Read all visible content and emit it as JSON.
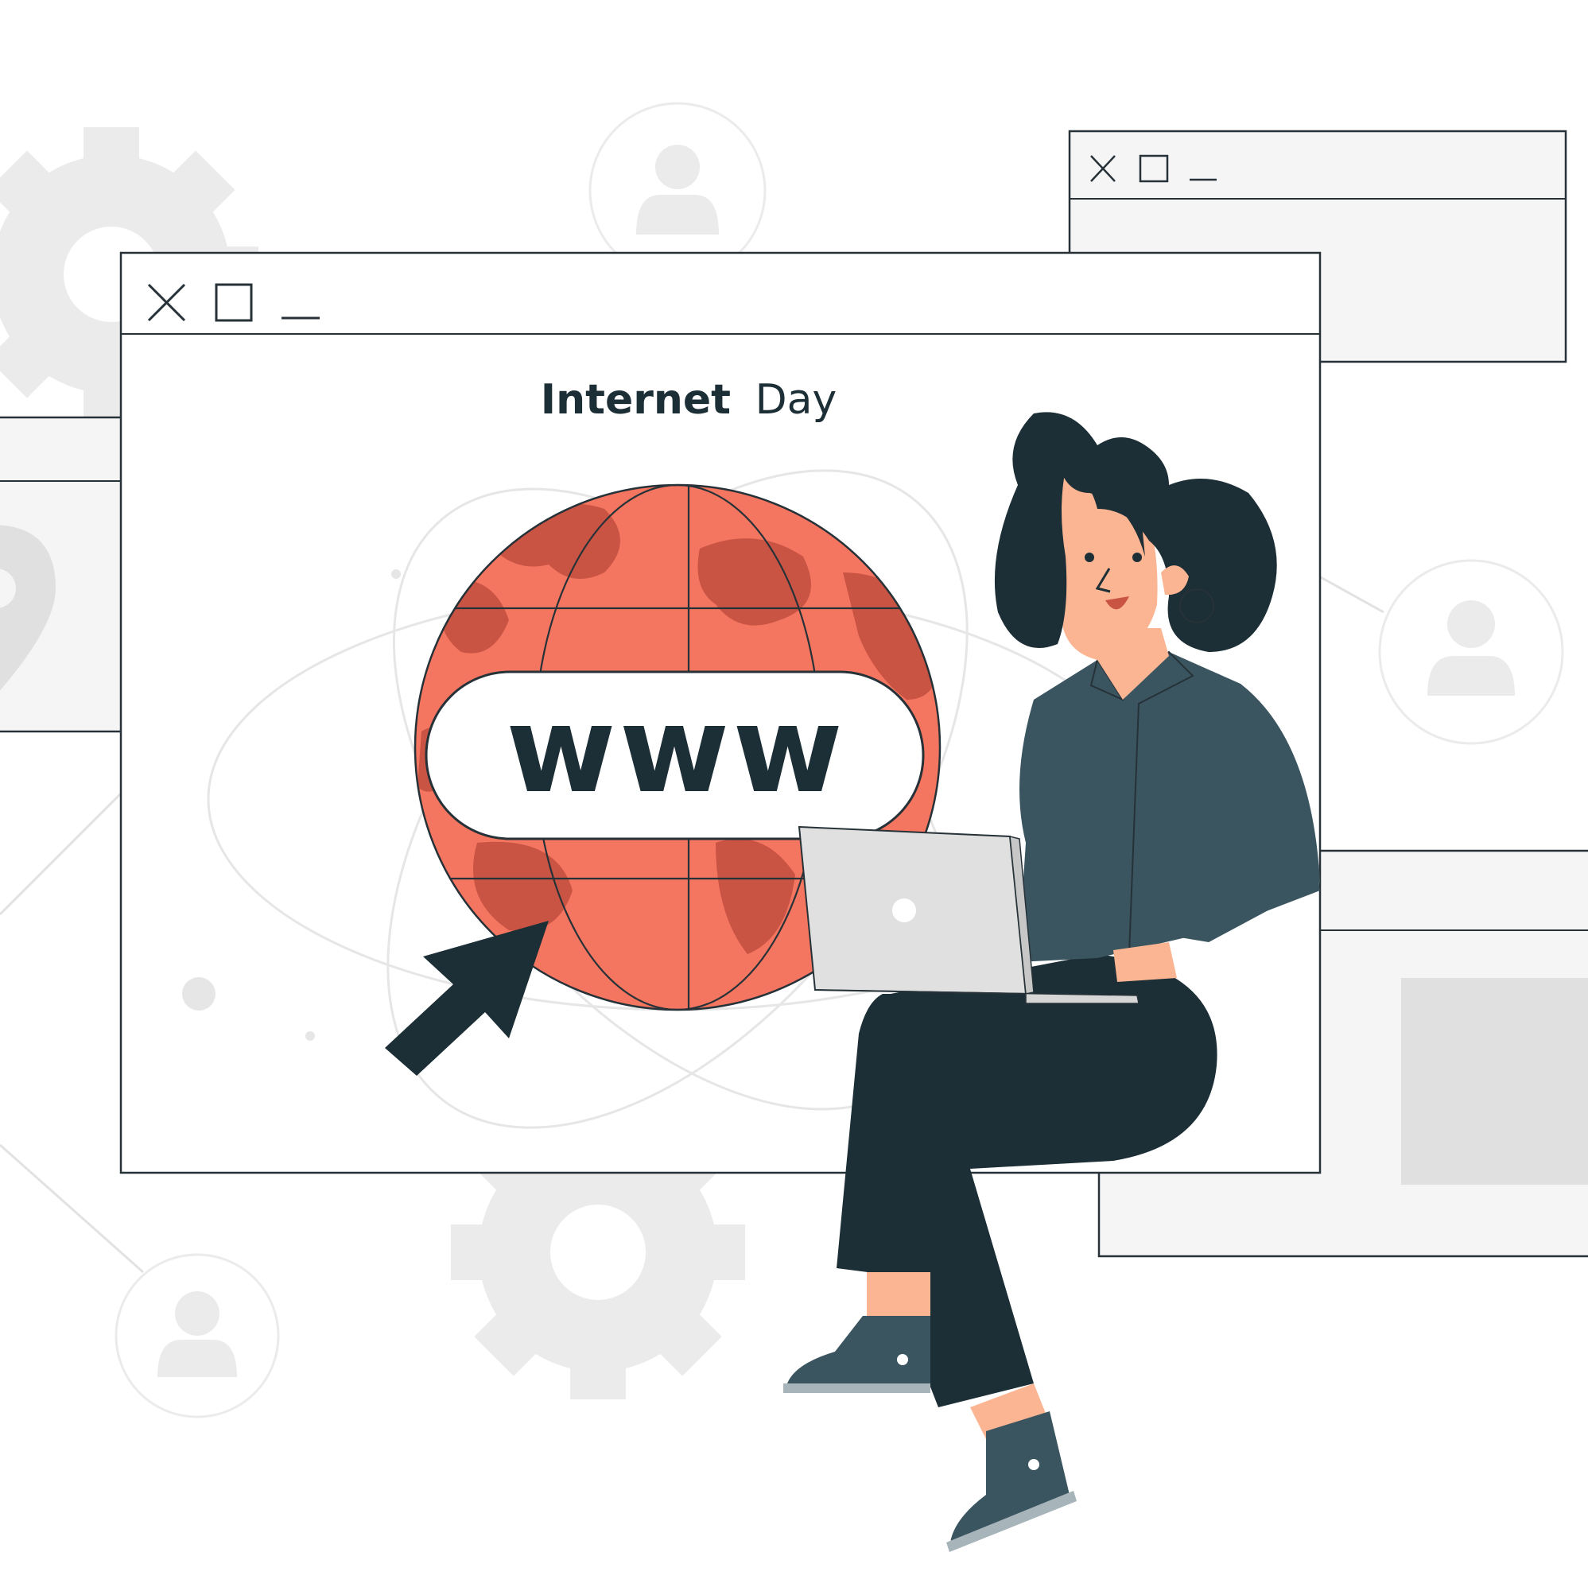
{
  "title": {
    "bold": "Internet",
    "regular": "Day"
  },
  "badge": {
    "text": "www"
  },
  "colors": {
    "globe": "#f47560",
    "globe_land": "#c95443",
    "dark": "#1c2e36",
    "shirt": "#3a5560",
    "skin": "#fcb592",
    "laptop": "#e0e0e0",
    "window_stroke": "#263238",
    "light_grey": "#ebebeb"
  },
  "icons": {
    "gears": "gear-icon",
    "profiles": "user-icon",
    "window_controls": [
      "close-icon",
      "maximize-icon",
      "minimize-icon"
    ],
    "pointer": "cursor-arrow-icon",
    "location": "map-pin-icon"
  }
}
